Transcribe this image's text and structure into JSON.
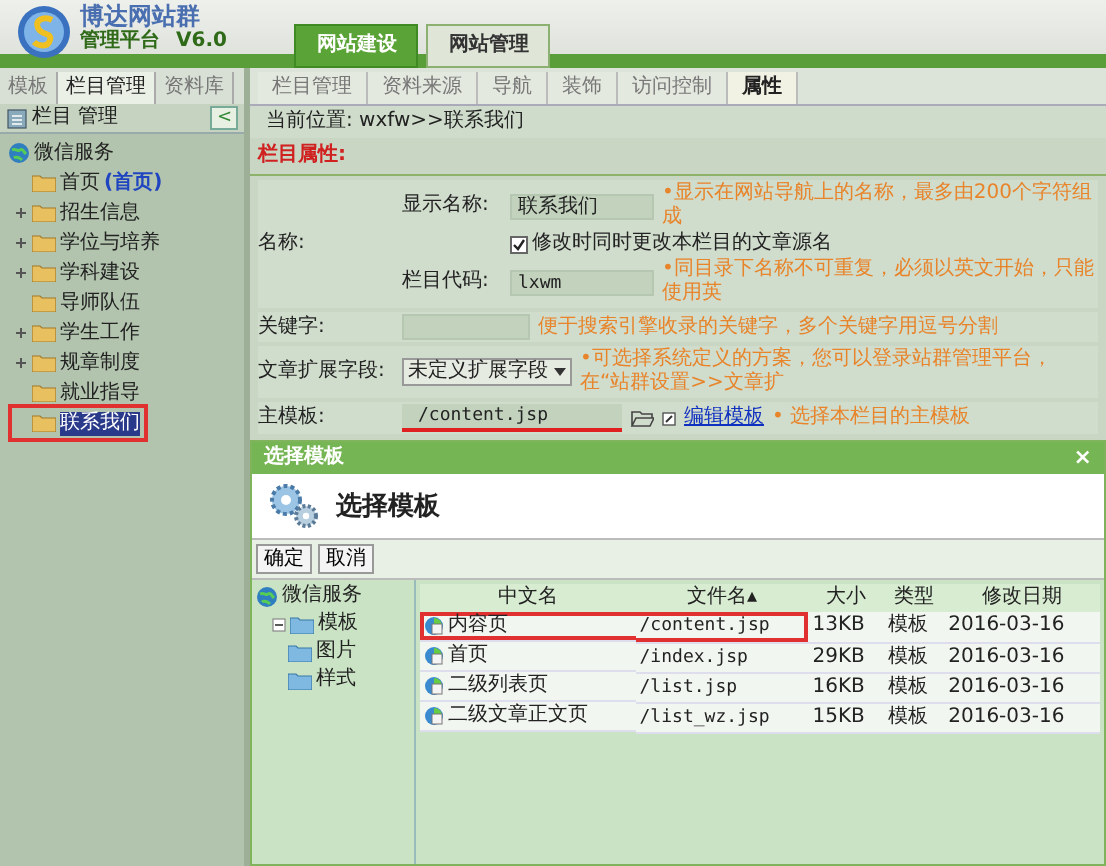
{
  "header": {
    "logo_title": "博达网站群",
    "logo_subtitle": "管理平台",
    "version": "V6.0",
    "tabs": [
      {
        "label": "网站建设",
        "selected": true
      },
      {
        "label": "网站管理",
        "selected": false
      }
    ]
  },
  "sidebar": {
    "tabs": [
      {
        "label": "模板",
        "selected": false
      },
      {
        "label": "栏目管理",
        "selected": true
      },
      {
        "label": "资料库",
        "selected": false
      }
    ],
    "title": "栏目 管理",
    "collapse": "<",
    "tree": [
      {
        "label": "微信服务",
        "selected": false,
        "highlighted": false,
        "children": [
          {
            "label": "首页",
            "tag": "(首页)",
            "expandable": false,
            "selected": false,
            "highlighted": false
          },
          {
            "label": "招生信息",
            "expandable": true,
            "selected": false,
            "highlighted": false
          },
          {
            "label": "学位与培养",
            "expandable": true,
            "selected": false,
            "highlighted": false
          },
          {
            "label": "学科建设",
            "expandable": true,
            "selected": false,
            "highlighted": false
          },
          {
            "label": "导师队伍",
            "expandable": false,
            "selected": false,
            "highlighted": false
          },
          {
            "label": "学生工作",
            "expandable": true,
            "selected": false,
            "highlighted": false
          },
          {
            "label": "规章制度",
            "expandable": true,
            "selected": false,
            "highlighted": false
          },
          {
            "label": "就业指导",
            "expandable": false,
            "selected": false,
            "highlighted": false
          },
          {
            "label": "联系我们",
            "expandable": false,
            "selected": true,
            "highlighted": true
          }
        ]
      }
    ]
  },
  "main": {
    "tabs": [
      {
        "label": "栏目管理",
        "selected": false
      },
      {
        "label": "资料来源",
        "selected": false
      },
      {
        "label": "导航",
        "selected": false
      },
      {
        "label": "装饰",
        "selected": false
      },
      {
        "label": "访问控制",
        "selected": false
      },
      {
        "label": "属性",
        "selected": true
      }
    ],
    "breadcrumb": "当前位置: wxfw>>联系我们",
    "section_title": "栏目属性:",
    "form": {
      "name_label": "名称:",
      "display_name_label": "显示名称:",
      "display_name": "联系我们",
      "display_name_hint": "•显示在网站导航上的名称，最多由200个字符组成",
      "rename_checkbox": {
        "label": "修改时同时更改本栏目的文章源名",
        "checked": true
      },
      "code_label": "栏目代码:",
      "code": "lxwm",
      "code_hint": "•同目录下名称不可重复，必须以英文开始，只能使用英",
      "keywords_label": "关键字:",
      "keywords_hint": "便于搜索引擎收录的关键字，多个关键字用逗号分割",
      "ext_label": "文章扩展字段:",
      "ext_value": "未定义扩展字段",
      "ext_hint": "•可选择系统定义的方案，您可以登录站群管理平台，在“站群设置>>文章扩",
      "template_label": "主模板:",
      "template": "/content.jsp",
      "template_underlined": true,
      "edit_link": "编辑模板",
      "template_hint": "• 选择本栏目的主模板"
    }
  },
  "dialog": {
    "title": "选择模板",
    "close": "×",
    "heading": "选择模板",
    "buttons": [
      "确定",
      "取消"
    ],
    "tree": [
      {
        "label": "微信服务",
        "children": [
          {
            "label": "模板",
            "expanded": true,
            "children": [
              {
                "label": "图片",
                "expanded": false
              },
              {
                "label": "样式",
                "expanded": false
              }
            ]
          }
        ]
      }
    ],
    "table": {
      "columns": [
        "中文名",
        "文件名▴",
        "大小",
        "类型",
        "修改日期"
      ],
      "rows": [
        {
          "cells": [
            "内容页",
            "/content.jsp",
            "13KB",
            "模板",
            "2016-03-16"
          ],
          "highlighted": true
        },
        {
          "cells": [
            "首页",
            "/index.jsp",
            "29KB",
            "模板",
            "2016-03-16"
          ],
          "highlighted": false
        },
        {
          "cells": [
            "二级列表页",
            "/list.jsp",
            "16KB",
            "模板",
            "2016-03-16"
          ],
          "highlighted": false
        },
        {
          "cells": [
            "二级文章正文页",
            "/list_wz.jsp",
            "15KB",
            "模板",
            "2016-03-16"
          ],
          "highlighted": false
        }
      ]
    }
  }
}
